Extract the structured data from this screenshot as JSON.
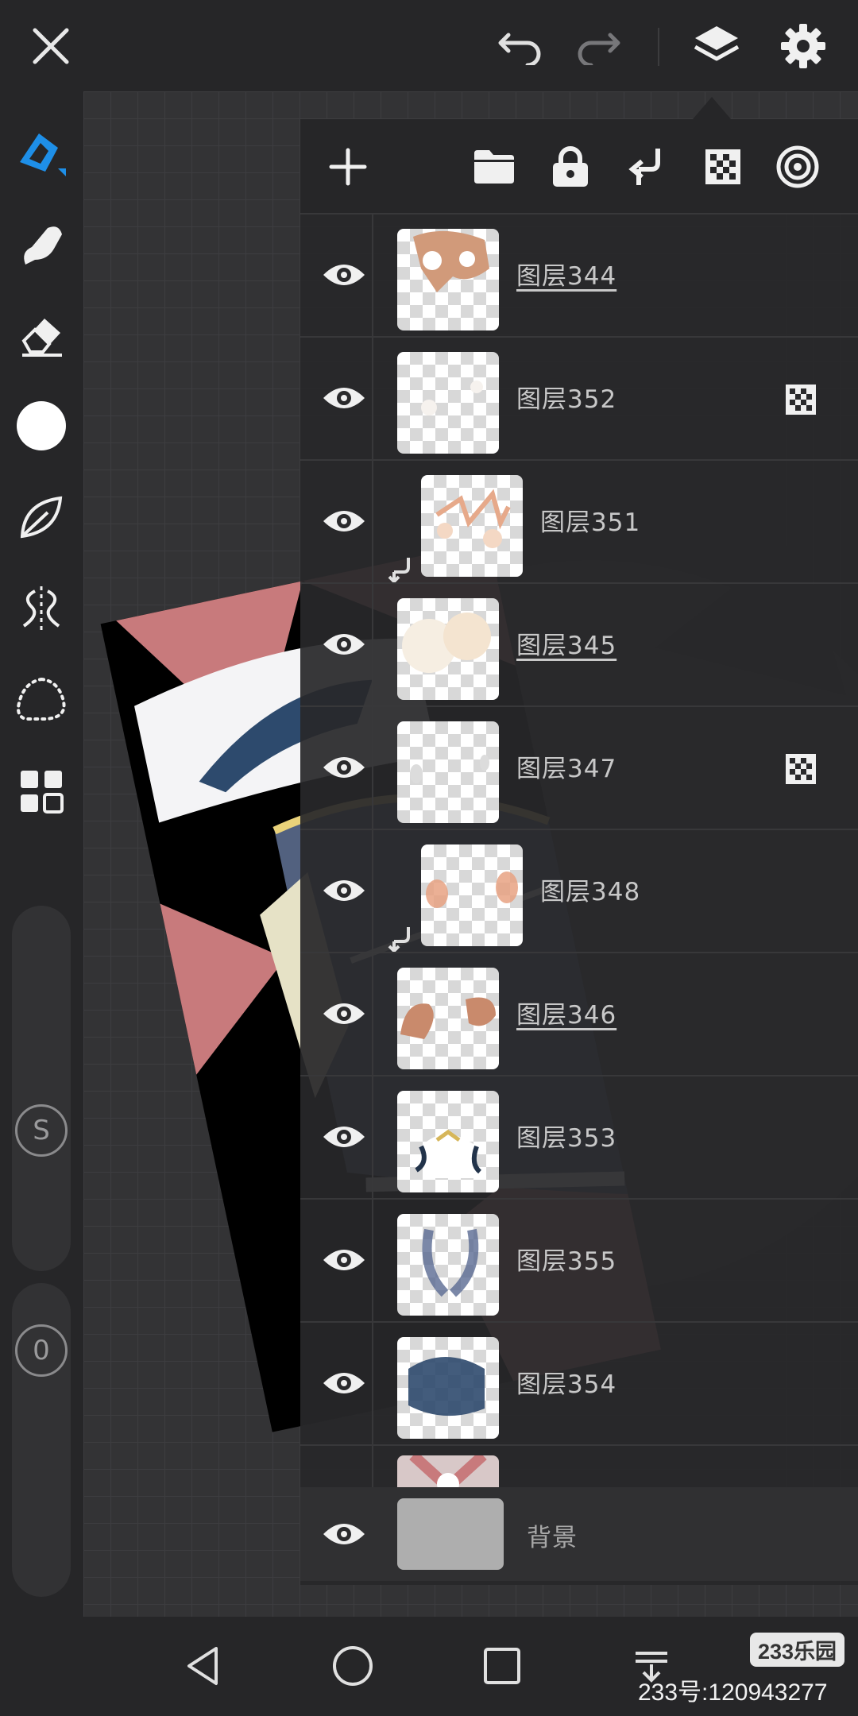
{
  "colors": {
    "accent": "#2196f3",
    "panel": "#262628"
  },
  "topbar": {
    "close": "close-icon",
    "undo": "undo-icon",
    "redo": "redo-icon",
    "layers": "layers-icon",
    "settings": "gear-icon"
  },
  "toolbar": {
    "tools": [
      "brush-icon",
      "smudge-icon",
      "eraser-icon",
      "color-circle",
      "leaf-shape-icon",
      "symmetry-icon",
      "lasso-icon",
      "grid-menu-icon"
    ],
    "size_label": "S",
    "opacity_label": "0"
  },
  "layers_panel": {
    "actions": [
      "add-icon",
      "folder-icon",
      "lock-icon",
      "clip-down-icon",
      "alpha-lock-icon",
      "blend-target-icon"
    ],
    "layers": [
      {
        "name": "图层344",
        "underline": true
      },
      {
        "name": "图层352",
        "alpha": true
      },
      {
        "name": "图层351",
        "clip": true
      },
      {
        "name": "图层345",
        "underline": true
      },
      {
        "name": "图层347",
        "alpha": true
      },
      {
        "name": "图层348",
        "clip": true
      },
      {
        "name": "图层346",
        "underline": true
      },
      {
        "name": "图层353"
      },
      {
        "name": "图层355"
      },
      {
        "name": "图层354"
      }
    ],
    "background_label": "背景"
  },
  "navbar": {
    "back": "back-icon",
    "home": "home-icon",
    "recents": "recents-icon",
    "menu": "menu-icon"
  },
  "watermark": {
    "logo": "233乐园",
    "id": "233号:120943277"
  }
}
